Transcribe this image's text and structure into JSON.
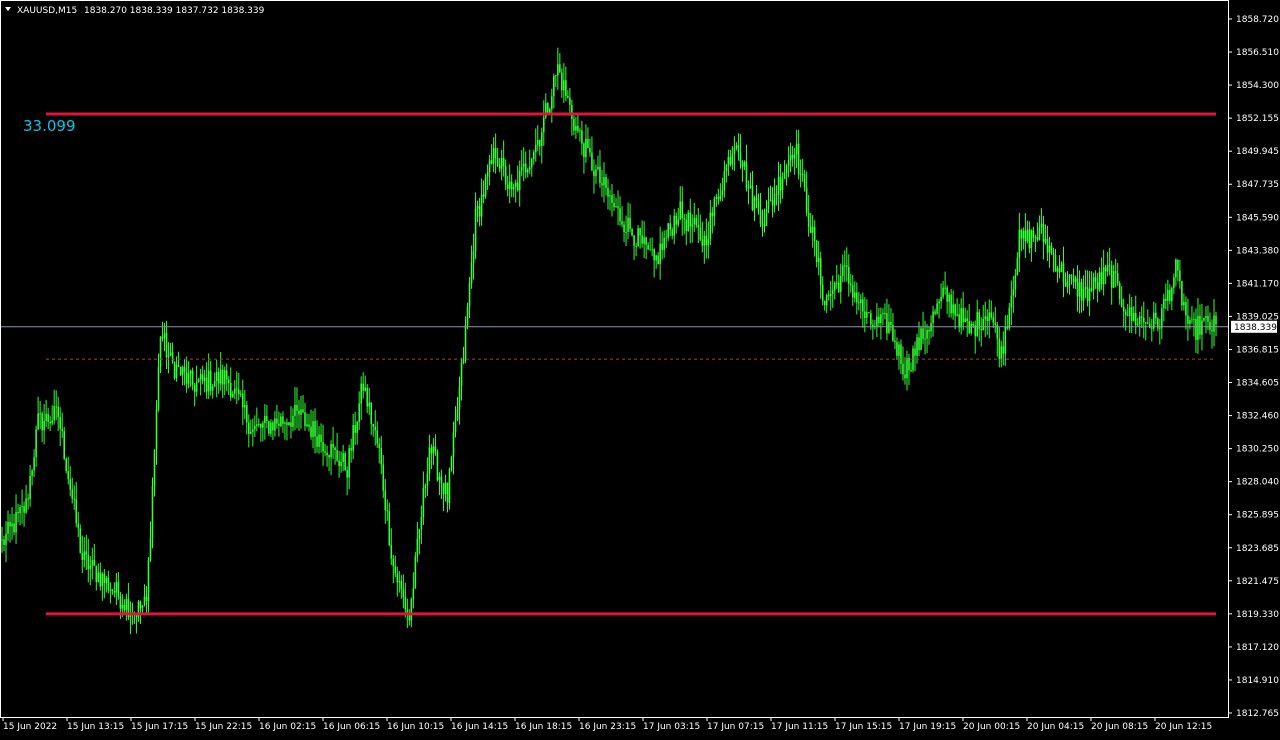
{
  "header": {
    "symbol_timeframe": "XAUUSD,M15",
    "ohlc": "1838.270 1838.339 1837.732 1838.339"
  },
  "range_label": "33.099",
  "current_price_label": "1838.339",
  "colors": {
    "background": "#000000",
    "candle": "#33ff33",
    "level_line": "#e0153a",
    "dashed_line": "#c0392b",
    "bid_line": "#8899aa",
    "range_text": "#00c8e6",
    "axis": "#ffffff"
  },
  "chart_data": {
    "type": "candlestick",
    "symbol": "XAUUSD",
    "timeframe": "M15",
    "ylim": [
      1812.765,
      1858.72
    ],
    "y_ticks": [
      "1858.720",
      "1856.510",
      "1854.300",
      "1852.155",
      "1849.945",
      "1847.735",
      "1845.590",
      "1843.380",
      "1841.170",
      "1839.025",
      "1836.815",
      "1834.605",
      "1832.460",
      "1830.250",
      "1828.040",
      "1825.895",
      "1823.685",
      "1821.475",
      "1819.330",
      "1817.120",
      "1814.910",
      "1812.765"
    ],
    "x_ticks": [
      "15 Jun 2022",
      "15 Jun 13:15",
      "15 Jun 17:15",
      "15 Jun 22:15",
      "16 Jun 02:15",
      "16 Jun 06:15",
      "16 Jun 10:15",
      "16 Jun 14:15",
      "16 Jun 18:15",
      "16 Jun 23:15",
      "17 Jun 03:15",
      "17 Jun 07:15",
      "17 Jun 11:15",
      "17 Jun 15:15",
      "17 Jun 19:15",
      "20 Jun 00:15",
      "20 Jun 04:15",
      "20 Jun 08:15",
      "20 Jun 12:15"
    ],
    "anchors": [
      {
        "i": 0,
        "p": 1824.0
      },
      {
        "i": 12,
        "p": 1826.5
      },
      {
        "i": 18,
        "p": 1832.0
      },
      {
        "i": 28,
        "p": 1832.5
      },
      {
        "i": 40,
        "p": 1823.0
      },
      {
        "i": 55,
        "p": 1821.0
      },
      {
        "i": 66,
        "p": 1819.5
      },
      {
        "i": 72,
        "p": 1820.0
      },
      {
        "i": 79,
        "p": 1838.0
      },
      {
        "i": 84,
        "p": 1836.0
      },
      {
        "i": 95,
        "p": 1834.5
      },
      {
        "i": 112,
        "p": 1835.0
      },
      {
        "i": 125,
        "p": 1831.5
      },
      {
        "i": 148,
        "p": 1832.5
      },
      {
        "i": 165,
        "p": 1830.0
      },
      {
        "i": 172,
        "p": 1829.0
      },
      {
        "i": 180,
        "p": 1834.5
      },
      {
        "i": 188,
        "p": 1830.0
      },
      {
        "i": 195,
        "p": 1822.5
      },
      {
        "i": 203,
        "p": 1819.0
      },
      {
        "i": 213,
        "p": 1830.5
      },
      {
        "i": 222,
        "p": 1827.0
      },
      {
        "i": 230,
        "p": 1836.5
      },
      {
        "i": 236,
        "p": 1845.5
      },
      {
        "i": 246,
        "p": 1850.0
      },
      {
        "i": 254,
        "p": 1847.0
      },
      {
        "i": 268,
        "p": 1851.0
      },
      {
        "i": 277,
        "p": 1855.5
      },
      {
        "i": 286,
        "p": 1851.5
      },
      {
        "i": 296,
        "p": 1848.5
      },
      {
        "i": 306,
        "p": 1846.0
      },
      {
        "i": 315,
        "p": 1844.5
      },
      {
        "i": 325,
        "p": 1842.5
      },
      {
        "i": 337,
        "p": 1846.0
      },
      {
        "i": 350,
        "p": 1844.0
      },
      {
        "i": 360,
        "p": 1848.5
      },
      {
        "i": 366,
        "p": 1851.0
      },
      {
        "i": 373,
        "p": 1847.0
      },
      {
        "i": 380,
        "p": 1845.5
      },
      {
        "i": 395,
        "p": 1850.5
      },
      {
        "i": 403,
        "p": 1845.0
      },
      {
        "i": 410,
        "p": 1840.0
      },
      {
        "i": 420,
        "p": 1842.0
      },
      {
        "i": 432,
        "p": 1838.5
      },
      {
        "i": 442,
        "p": 1838.5
      },
      {
        "i": 450,
        "p": 1835.5
      },
      {
        "i": 460,
        "p": 1838.0
      },
      {
        "i": 470,
        "p": 1840.5
      },
      {
        "i": 482,
        "p": 1838.0
      },
      {
        "i": 492,
        "p": 1839.5
      },
      {
        "i": 498,
        "p": 1836.5
      },
      {
        "i": 507,
        "p": 1844.0
      },
      {
        "i": 518,
        "p": 1844.5
      },
      {
        "i": 530,
        "p": 1841.5
      },
      {
        "i": 540,
        "p": 1840.5
      },
      {
        "i": 552,
        "p": 1842.0
      },
      {
        "i": 562,
        "p": 1839.0
      },
      {
        "i": 576,
        "p": 1838.5
      },
      {
        "i": 585,
        "p": 1842.0
      },
      {
        "i": 592,
        "p": 1838.0
      },
      {
        "i": 598,
        "p": 1838.5
      },
      {
        "i": 605,
        "p": 1838.3
      }
    ],
    "bar_count": 606,
    "levels": {
      "resistance": 1852.43,
      "support": 1819.33,
      "dashed": 1836.2,
      "bid": 1838.339
    }
  }
}
